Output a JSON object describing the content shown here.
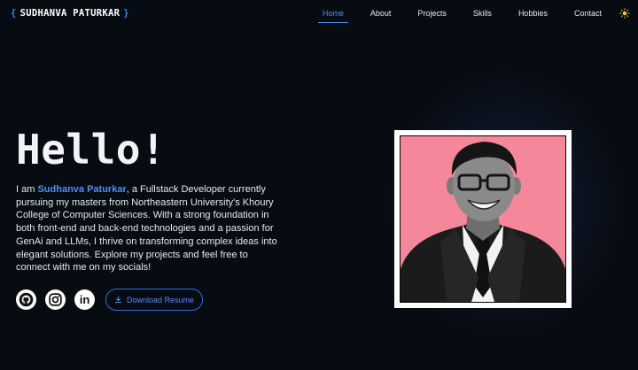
{
  "brand": {
    "open_brace": "{",
    "name": "SUDHANVA PATURKAR",
    "close_brace": "}"
  },
  "nav": {
    "items": [
      {
        "label": "Home",
        "active": true
      },
      {
        "label": "About"
      },
      {
        "label": "Projects"
      },
      {
        "label": "Skills"
      },
      {
        "label": "Hobbies"
      },
      {
        "label": "Contact"
      }
    ],
    "theme_icon": "sun-icon"
  },
  "hero": {
    "title": "Hello!",
    "bio_prefix": "I am ",
    "bio_name": "Sudhanva Paturkar",
    "bio_rest": ", a Fullstack Developer currently pursuing my masters from Northeastern University's Khoury College of Computer Sciences. With a strong foundation in both front-end and back-end technologies and a passion for GenAi and LLMs, I thrive on transforming complex ideas into elegant solutions. Explore my projects and feel free to connect with me on my socials!"
  },
  "socials": [
    {
      "icon": "github-icon"
    },
    {
      "icon": "instagram-icon"
    },
    {
      "icon": "linkedin-icon",
      "text": "in"
    }
  ],
  "resume_button": {
    "label": "Download Resume",
    "icon": "download-icon"
  },
  "photo": {
    "background": "#f5879a"
  },
  "colors": {
    "accent": "#4f8ff7",
    "background": "#070b12",
    "text": "#e6e9ef"
  }
}
